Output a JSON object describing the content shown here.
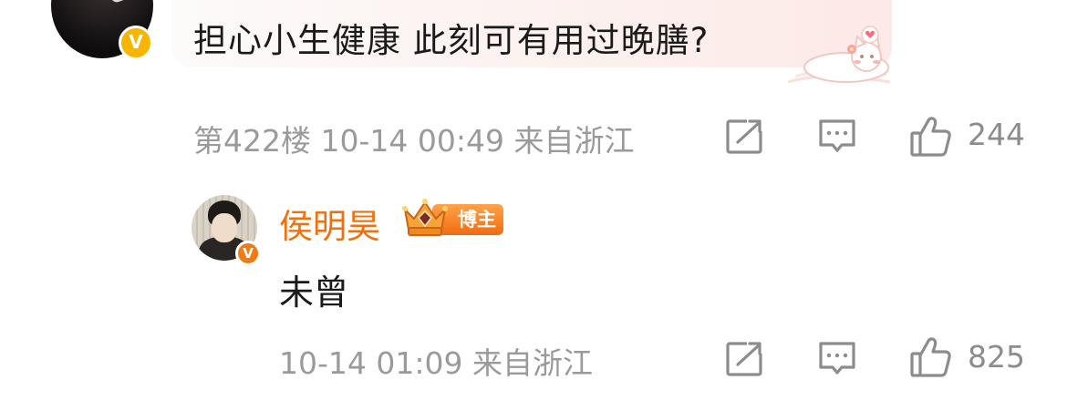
{
  "top_comment": {
    "text": "担心小生健康 此刻可有用过晚膳?",
    "floor": "第422楼",
    "time": "10-14 00:49",
    "location": "来自浙江",
    "likes": "244"
  },
  "reply": {
    "username": "侯明昊",
    "badge": "博主",
    "text": "未曾",
    "time": "10-14 01:09",
    "location": "来自浙江",
    "likes": "825"
  },
  "verified_mark": "V",
  "icons": {
    "share": "share-icon",
    "comment": "comment-icon",
    "like": "thumbs-up-icon"
  },
  "colors": {
    "accent_orange": "#f0700f",
    "verified_yellow": "#f7b500",
    "meta_gray": "#9a9a9a",
    "icon_gray": "#8c8c8c"
  }
}
